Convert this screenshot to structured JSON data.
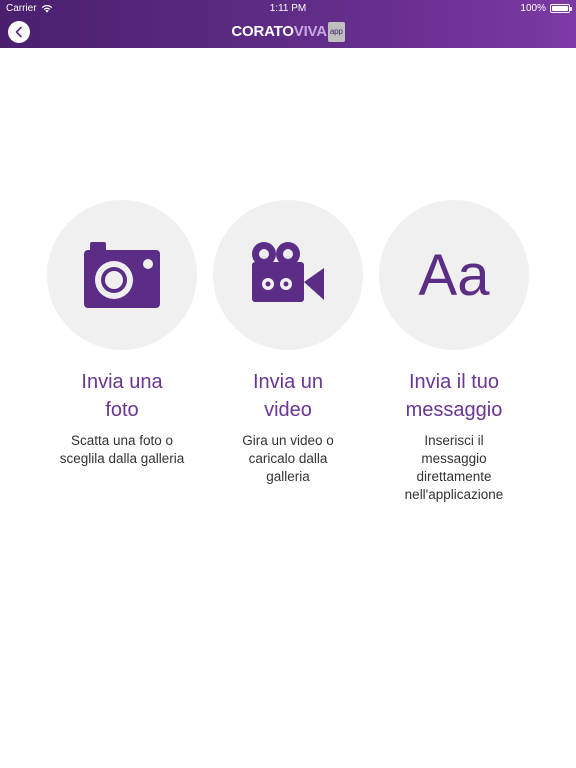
{
  "status_bar": {
    "carrier": "Carrier",
    "time": "1:11 PM",
    "battery": "100%"
  },
  "header": {
    "brand_main": "CORATO",
    "brand_accent": "VIVA",
    "brand_badge": "app"
  },
  "options": [
    {
      "icon": "camera-icon",
      "title_line1": "Invia una",
      "title_line2": "foto",
      "description": "Scatta una foto o sceglila dalla galleria"
    },
    {
      "icon": "video-camera-icon",
      "title_line1": "Invia un",
      "title_line2": "video",
      "description": "Gira un video o caricalo dalla galleria"
    },
    {
      "icon": "text-icon",
      "icon_text": "Aa",
      "title_line1": "Invia il tuo",
      "title_line2": "messaggio",
      "description": "Inserisci il messaggio direttamente nell'applicazione"
    }
  ],
  "colors": {
    "header_gradient_start": "#4a1f6e",
    "header_gradient_end": "#7d3aa5",
    "accent_purple": "#5b2d86",
    "title_purple": "#6a3593",
    "circle_bg": "#f0f0f0"
  }
}
